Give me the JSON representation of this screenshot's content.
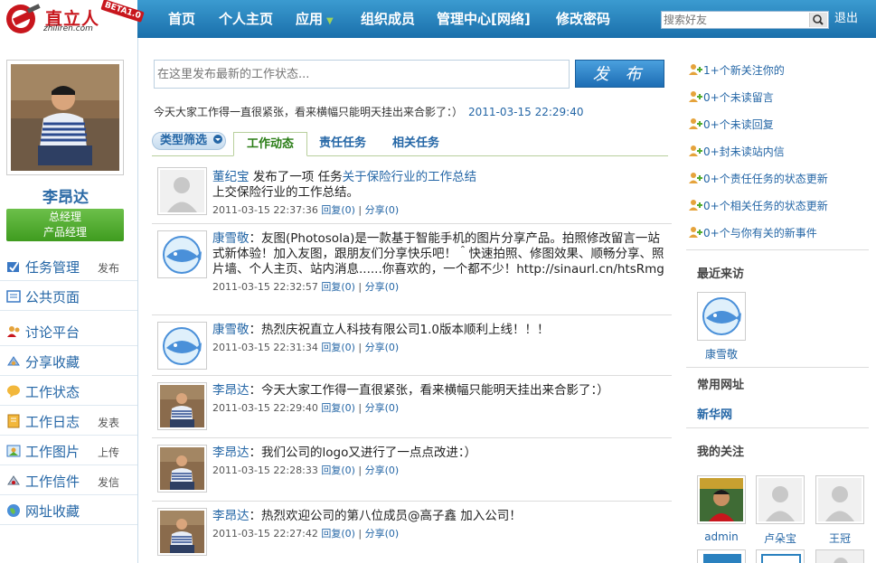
{
  "brand": {
    "name": "直立人",
    "domain": "zhiliren.com",
    "badge": "BETA1.0",
    "colors": {
      "header": "#2a81bf",
      "brand_red": "#c8161d",
      "link": "#2466a6",
      "role_badge": "#52ab30"
    }
  },
  "nav": {
    "items": [
      {
        "label": "首页"
      },
      {
        "label": "个人主页"
      },
      {
        "label": "应用",
        "dropdown_icon": "chevron-down-icon"
      },
      {
        "label": "组织成员"
      },
      {
        "label": "管理中心[网络]"
      },
      {
        "label": "修改密码"
      }
    ],
    "search_placeholder": "搜索好友",
    "logout": "退出"
  },
  "profile": {
    "name": "李昂达",
    "role_line1": "总经理",
    "role_line2": "产品经理"
  },
  "sidebar": [
    {
      "label": "任务管理",
      "action": "发布",
      "icon": "task-icon"
    },
    {
      "label": "公共页面",
      "action": "",
      "icon": "page-icon"
    },
    {
      "label": "讨论平台",
      "action": "",
      "icon": "discussion-icon"
    },
    {
      "label": "分享收藏",
      "action": "",
      "icon": "share-icon"
    },
    {
      "label": "工作状态",
      "action": "",
      "icon": "status-icon"
    },
    {
      "label": "工作日志",
      "action": "发表",
      "icon": "log-icon"
    },
    {
      "label": "工作图片",
      "action": "上传",
      "icon": "picture-icon"
    },
    {
      "label": "工作信件",
      "action": "发信",
      "icon": "mail-icon"
    },
    {
      "label": "网址收藏",
      "action": "",
      "icon": "globe-icon"
    }
  ],
  "composer": {
    "placeholder": "在这里发布最新的工作状态...",
    "publish": "发 布",
    "last_status": "今天大家工作得一直很紧张，看来横幅只能明天挂出来合影了：）",
    "last_status_time": "2011-03-15 22:29:40"
  },
  "tabs": {
    "filter": "类型筛选",
    "items": [
      "工作动态",
      "责任任务",
      "相关任务"
    ],
    "active": "工作动态"
  },
  "feed": [
    {
      "author": "董纪宝",
      "avatar": "default-avatar",
      "text": " 发布了一项 任务",
      "link": "关于保险行业的工作总结",
      "line2": "上交保险行业的工作总结。",
      "time": "2011-03-15 22:37:36",
      "reply": "回复(0)",
      "share": "分享(0)"
    },
    {
      "author": "康雪敬",
      "avatar": "whale-avatar",
      "text": "：友图(Photosola)是一款基于智能手机的图片分享产品。拍照修改留言一站式新体验！加入友图，跟朋友们分享快乐吧！＾快速拍照、修图效果、顺畅分享、照片墙、个人主页、站内消息......你喜欢的，一个都不少！http://sinaurl.cn/htsRmg",
      "time": "2011-03-15 22:32:57",
      "reply": "回复(0)",
      "share": "分享(0)"
    },
    {
      "author": "康雪敬",
      "avatar": "whale-avatar",
      "text": "：热烈庆祝直立人科技有限公司1.0版本顺利上线！！！",
      "time": "2011-03-15 22:31:34",
      "reply": "回复(0)",
      "share": "分享(0)"
    },
    {
      "author": "李昂达",
      "avatar": "user-photo",
      "text": "：今天大家工作得一直很紧张，看来横幅只能明天挂出来合影了：）",
      "time": "2011-03-15 22:29:40",
      "reply": "回复(0)",
      "share": "分享(0)"
    },
    {
      "author": "李昂达",
      "avatar": "user-photo",
      "text": "：我们公司的logo又进行了一点点改进：）",
      "time": "2011-03-15 22:28:33",
      "reply": "回复(0)",
      "share": "分享(0)"
    },
    {
      "author": "李昂达",
      "avatar": "user-photo",
      "text": "：热烈欢迎公司的第八位成员@高子鑫 加入公司！",
      "time": "2011-03-15 22:27:42",
      "reply": "回复(0)",
      "share": "分享(0)"
    }
  ],
  "notifications": [
    "1+个新关注你的",
    "0+个未读留言",
    "0+个未读回复",
    "0+封未读站内信",
    "0+个责任任务的状态更新",
    "0+个相关任务的状态更新",
    "0+个与你有关的新事件"
  ],
  "recent_visitors": {
    "title": "最近来访",
    "items": [
      {
        "name": "康雪敬",
        "avatar": "whale-avatar"
      }
    ]
  },
  "common_links": {
    "title": "常用网址",
    "items": [
      "新华网"
    ]
  },
  "following": {
    "title": "我的关注",
    "items": [
      {
        "name": "admin",
        "avatar": "admin-photo"
      },
      {
        "name": "卢朵宝",
        "avatar": "default-avatar"
      },
      {
        "name": "王冠",
        "avatar": "default-avatar"
      }
    ]
  }
}
